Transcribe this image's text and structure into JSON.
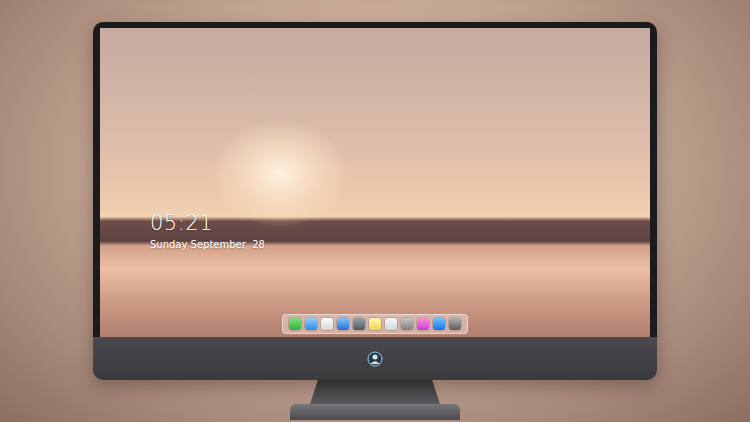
{
  "lock_screen": {
    "time": "05:21",
    "date": "Sunday September  28"
  }
}
